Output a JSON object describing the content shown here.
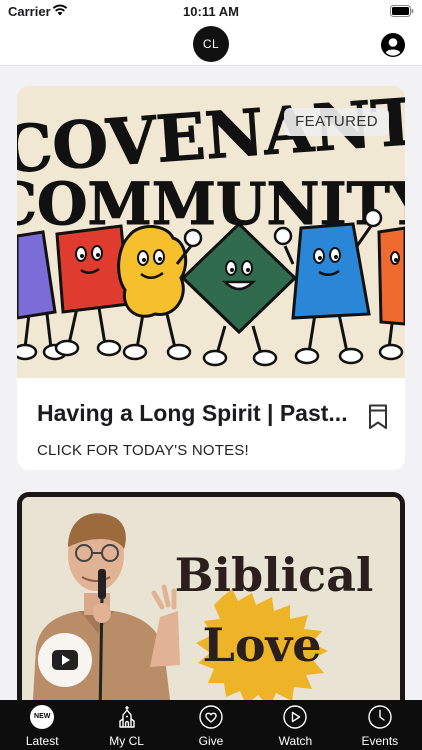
{
  "status_bar": {
    "carrier": "Carrier",
    "time": "10:11 AM"
  },
  "header": {
    "logo": "CL"
  },
  "featured_card": {
    "badge": "FEATURED",
    "title": "Having a Long Spirit | Past...",
    "subtitle": "CLICK FOR TODAY'S NOTES!",
    "artwork_text": [
      "COVENANT",
      "COMMUNITY"
    ]
  },
  "second_card": {
    "artwork_text": [
      "Biblical",
      "Love"
    ]
  },
  "tab_bar": {
    "tabs": [
      {
        "label": "Latest",
        "icon": "new-badge-icon",
        "badge": "NEW"
      },
      {
        "label": "My CL",
        "icon": "church-icon"
      },
      {
        "label": "Give",
        "icon": "heart-icon"
      },
      {
        "label": "Watch",
        "icon": "play-icon"
      },
      {
        "label": "Events",
        "icon": "clock-icon"
      }
    ]
  },
  "colors": {
    "background": "#f2f2f4",
    "tab_bar": "#0d0d0d",
    "artwork_red": "#e03b2f",
    "artwork_yellow": "#f6c02d",
    "artwork_green": "#2f6b4c",
    "artwork_blue": "#2a86d6",
    "artwork_orange": "#ef6a2e",
    "artwork_purple": "#7c6cd8",
    "love_yellow": "#eeb428"
  }
}
